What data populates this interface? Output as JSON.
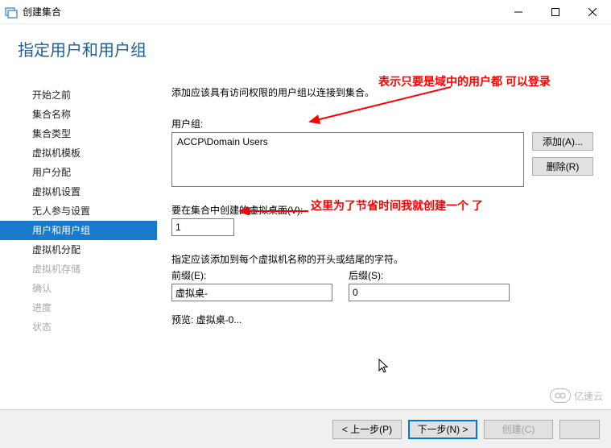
{
  "window": {
    "title": "创建集合",
    "min_tooltip": "最小化",
    "max_tooltip": "最大化",
    "close_tooltip": "关闭"
  },
  "page_title": "指定用户和用户组",
  "sidebar": {
    "items": [
      {
        "label": "开始之前",
        "state": "normal"
      },
      {
        "label": "集合名称",
        "state": "normal"
      },
      {
        "label": "集合类型",
        "state": "normal"
      },
      {
        "label": "虚拟机模板",
        "state": "normal"
      },
      {
        "label": "用户分配",
        "state": "normal"
      },
      {
        "label": "虚拟机设置",
        "state": "normal"
      },
      {
        "label": "无人参与设置",
        "state": "normal"
      },
      {
        "label": "用户和用户组",
        "state": "selected"
      },
      {
        "label": "虚拟机分配",
        "state": "normal"
      },
      {
        "label": "虚拟机存储",
        "state": "disabled"
      },
      {
        "label": "确认",
        "state": "disabled"
      },
      {
        "label": "进度",
        "state": "disabled"
      },
      {
        "label": "状态",
        "state": "disabled"
      }
    ]
  },
  "main": {
    "desc": "添加应该具有访问权限的用户组以连接到集合。",
    "user_group_label": "用户组:",
    "user_group_value": "ACCP\\Domain Users",
    "add_button": "添加(A)...",
    "remove_button": "删除(R)",
    "count_label": "要在集合中创建的虚拟桌面(V):",
    "count_value": "1",
    "naming_note": "指定应该添加到每个虚拟机名称的开头或结尾的字符。",
    "prefix_label": "前缀(E):",
    "prefix_value": "虚拟桌-",
    "suffix_label": "后缀(S):",
    "suffix_value": "0",
    "preview_label": "预览:",
    "preview_value": "虚拟桌-0..."
  },
  "annotations": {
    "anno1": "表示只要是域中的用户都\n可以登录",
    "anno2": "这里为了节省时间我就创建一个\n了"
  },
  "footer": {
    "prev": "< 上一步(P)",
    "next": "下一步(N) >",
    "create": "创建(C)",
    "cancel": ""
  },
  "watermark": "亿速云"
}
